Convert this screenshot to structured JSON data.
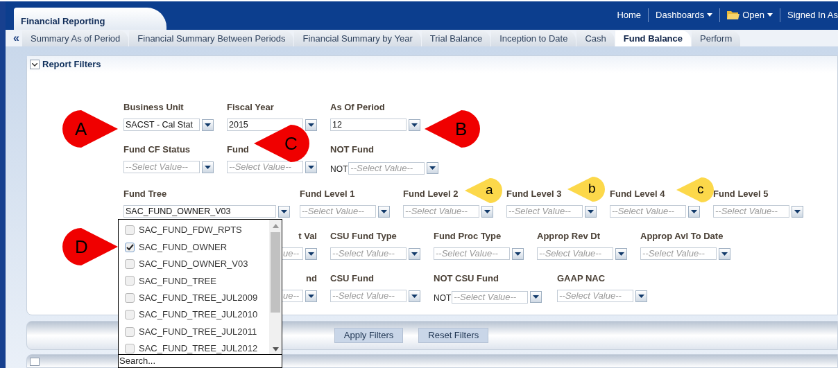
{
  "header": {
    "title": "Financial Reporting",
    "links": [
      {
        "label": "Home",
        "kind": "plain"
      },
      {
        "label": "Dashboards",
        "kind": "menu"
      },
      {
        "label": "Open",
        "kind": "folder-menu"
      },
      {
        "label": "Signed In As",
        "kind": "plain"
      }
    ]
  },
  "tabs": {
    "scroll_left": "«",
    "items": [
      {
        "label": "Summary As of Period",
        "selected": false
      },
      {
        "label": "Financial Summary Between Periods",
        "selected": false
      },
      {
        "label": "Financial Summary by Year",
        "selected": false
      },
      {
        "label": "Trial Balance",
        "selected": false
      },
      {
        "label": "Inception to Date",
        "selected": false
      },
      {
        "label": "Cash",
        "selected": false
      },
      {
        "label": "Fund Balance",
        "selected": true
      },
      {
        "label": "Perform",
        "selected": false
      }
    ]
  },
  "filters_panel": {
    "title": "Report Filters",
    "expanded": true,
    "rows": [
      {
        "fields": [
          {
            "kind": "normal",
            "label": "Business Unit",
            "value": "SACST - Cal Stat"
          },
          {
            "kind": "normal",
            "label": "Fiscal Year",
            "value": "2015"
          },
          {
            "kind": "normal",
            "label": "As Of Period",
            "value": "12"
          }
        ]
      },
      {
        "fields": [
          {
            "kind": "normal",
            "label": "Fund CF Status",
            "placeholder": "--Select Value--"
          },
          {
            "kind": "normal",
            "label": "Fund",
            "placeholder": "--Select Value--"
          },
          {
            "kind": "not",
            "label": "NOT Fund",
            "prefix": "NOT",
            "placeholder": "--Select Value--"
          }
        ]
      },
      {
        "fields": [
          {
            "kind": "wide",
            "label": "Fund Tree",
            "value": "SAC_FUND_OWNER_V03"
          },
          {
            "kind": "normal",
            "label": "Fund Level 1",
            "placeholder": "--Select Value--"
          },
          {
            "kind": "normal",
            "label": "Fund Level 2",
            "placeholder": "--Select Value--"
          },
          {
            "kind": "normal",
            "label": "Fund Level 3",
            "placeholder": "--Select Value--"
          },
          {
            "kind": "normal",
            "label": "Fund Level 4",
            "placeholder": "--Select Value--"
          },
          {
            "kind": "normal",
            "label": "Fund Level 5",
            "placeholder": "--Select Value--"
          }
        ]
      },
      {
        "fields": [
          {
            "kind": "partial",
            "label": "t Val",
            "placeholder": "ue--"
          },
          {
            "kind": "normal",
            "label": "CSU Fund Type",
            "placeholder": "--Select Value--"
          },
          {
            "kind": "normal",
            "label": "Fund Proc Type",
            "placeholder": "--Select Value--"
          },
          {
            "kind": "normal",
            "label": "Approp Rev Dt",
            "placeholder": "--Select Value--"
          },
          {
            "kind": "normal",
            "label": "Approp Avl To Date",
            "placeholder": "--Select Value--"
          }
        ]
      },
      {
        "fields": [
          {
            "kind": "partial",
            "label": "nd",
            "placeholder": "ue--"
          },
          {
            "kind": "normal",
            "label": "CSU Fund",
            "placeholder": "--Select Value--"
          },
          {
            "kind": "not",
            "label": "NOT CSU Fund",
            "prefix": "NOT",
            "placeholder": "--Select Value--"
          },
          {
            "kind": "normal",
            "label": "GAAP NAC",
            "placeholder": "--Select Value--"
          }
        ]
      }
    ]
  },
  "dropdown_list": {
    "items": [
      {
        "label": "SAC_FUND_FDW_RPTS",
        "checked": false
      },
      {
        "label": "SAC_FUND_OWNER",
        "checked": true
      },
      {
        "label": "SAC_FUND_OWNER_V03",
        "checked": false
      },
      {
        "label": "SAC_FUND_TREE",
        "checked": false
      },
      {
        "label": "SAC_FUND_TREE_JUL2009",
        "checked": false
      },
      {
        "label": "SAC_FUND_TREE_JUL2010",
        "checked": false
      },
      {
        "label": "SAC_FUND_TREE_JUL2011",
        "checked": false
      },
      {
        "label": "SAC_FUND_TREE_JUL2012",
        "checked": false
      }
    ],
    "search_placeholder": "Search..."
  },
  "buttons": [
    "Apply Filters",
    "Reset Filters"
  ],
  "callouts": [
    {
      "letter": "A",
      "kind": "points-right",
      "color": "#f00000"
    },
    {
      "letter": "B",
      "kind": "points-left",
      "color": "#f00000"
    },
    {
      "letter": "C",
      "kind": "points-left",
      "color": "#f00000"
    },
    {
      "letter": "D",
      "kind": "points-right",
      "color": "#f00000"
    },
    {
      "letter": "a",
      "kind": "points-left",
      "color": "#fcd84a"
    },
    {
      "letter": "b",
      "kind": "points-left",
      "color": "#fcd84a"
    },
    {
      "letter": "c",
      "kind": "points-left",
      "color": "#fcd84a"
    }
  ]
}
